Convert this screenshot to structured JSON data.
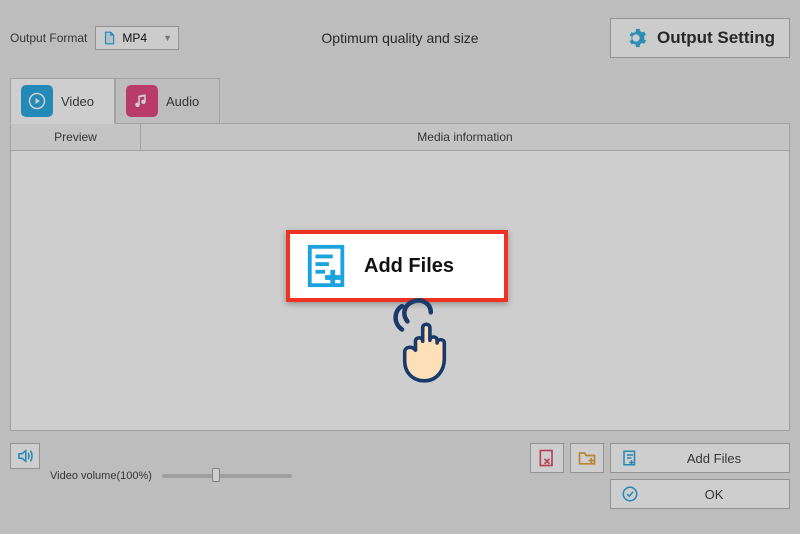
{
  "toolbar": {
    "output_format_label": "Output Format",
    "format_value": "MP4",
    "center_text": "Optimum quality and size",
    "output_setting_label": "Output Setting"
  },
  "tabs": {
    "video": "Video",
    "audio": "Audio"
  },
  "columns": {
    "preview": "Preview",
    "media_info": "Media information"
  },
  "popup": {
    "label": "Add Files"
  },
  "bottom": {
    "volume_label": "Video volume(100%)",
    "add_files": "Add Files",
    "ok": "OK"
  }
}
